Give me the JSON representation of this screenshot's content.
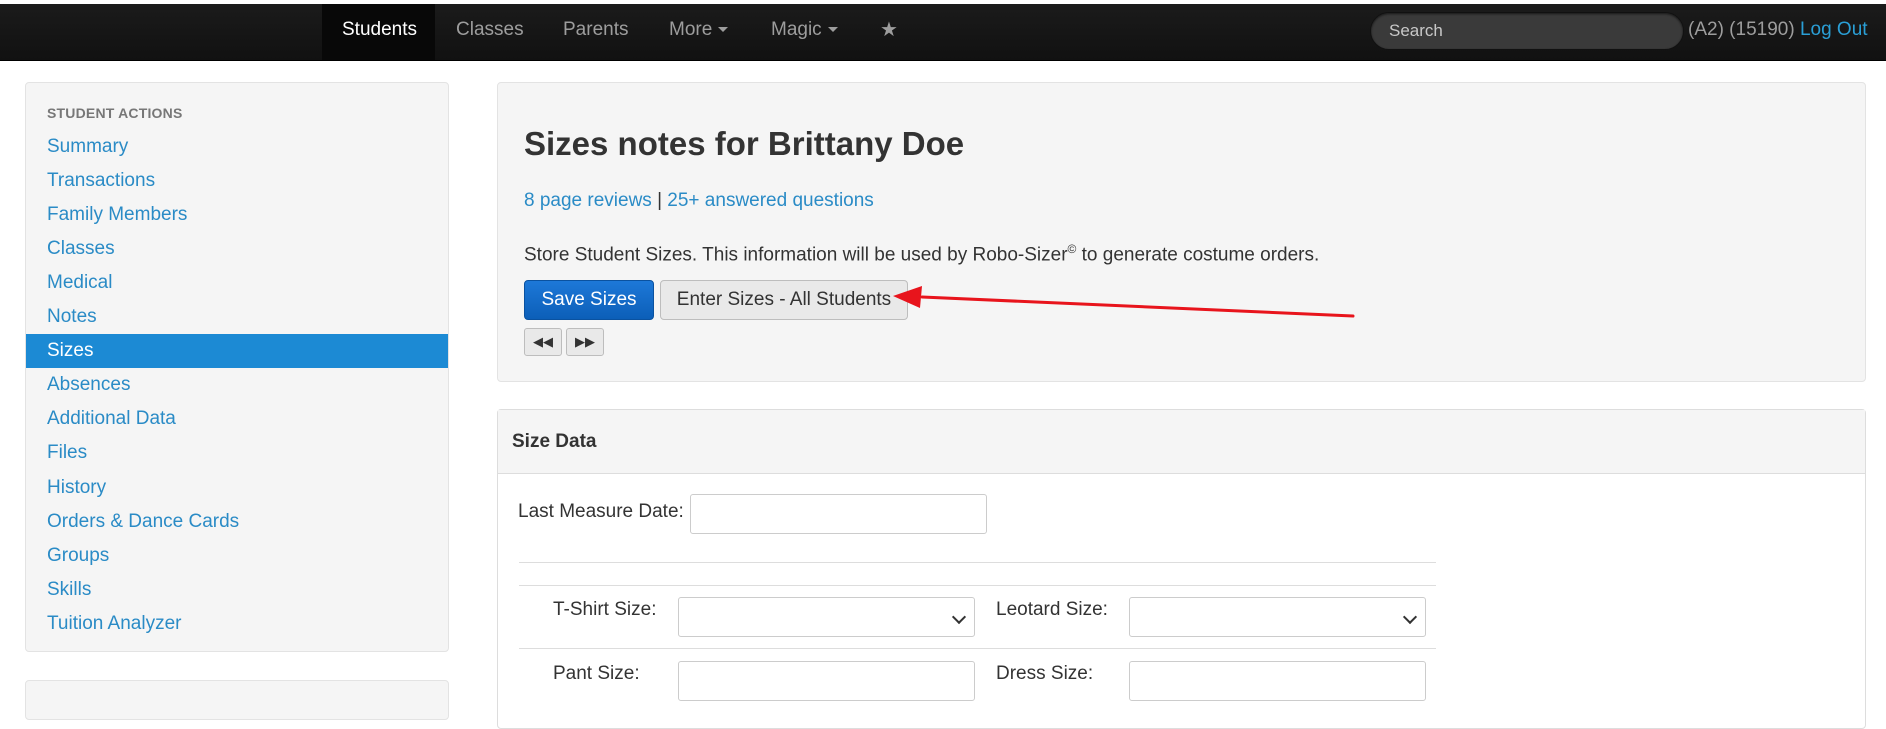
{
  "navbar": {
    "items": [
      {
        "label": "Students",
        "active": true
      },
      {
        "label": "Classes"
      },
      {
        "label": "Parents"
      },
      {
        "label": "More",
        "dropdown": true
      },
      {
        "label": "Magic",
        "dropdown": true
      }
    ],
    "star_icon": "star-icon",
    "search_placeholder": "Search",
    "user_info": "(A2) (15190)",
    "logout_label": "Log Out"
  },
  "sidebar": {
    "header": "STUDENT ACTIONS",
    "items": [
      {
        "label": "Summary"
      },
      {
        "label": "Transactions"
      },
      {
        "label": "Family Members"
      },
      {
        "label": "Classes"
      },
      {
        "label": "Medical"
      },
      {
        "label": "Notes"
      },
      {
        "label": "Sizes",
        "active": true
      },
      {
        "label": "Absences"
      },
      {
        "label": "Additional Data"
      },
      {
        "label": "Files"
      },
      {
        "label": "History"
      },
      {
        "label": "Orders & Dance Cards"
      },
      {
        "label": "Groups"
      },
      {
        "label": "Skills"
      },
      {
        "label": "Tuition Analyzer"
      }
    ]
  },
  "main": {
    "title": "Sizes notes for Brittany Doe",
    "reviews_link": "8 page reviews",
    "separator": "|",
    "questions_link": "25+ answered questions",
    "desc_before": "Store Student Sizes. This information will be used by Robo-Sizer",
    "desc_sup": "©",
    "desc_after": " to generate costume orders.",
    "save_button": "Save Sizes",
    "enter_all_button": "Enter Sizes - All Students",
    "prev_icon": "backward-icon",
    "next_icon": "forward-icon",
    "arrow_color": "#e8141c"
  },
  "size_panel": {
    "title": "Size Data",
    "last_measure_label": "Last Measure Date:",
    "last_measure_value": "",
    "tshirt_label": "T-Shirt Size:",
    "tshirt_value": "",
    "leotard_label": "Leotard Size:",
    "leotard_value": "",
    "pant_label": "Pant Size:",
    "pant_value": "",
    "dress_label": "Dress Size:",
    "dress_value": ""
  },
  "colors": {
    "navbar_bg": "#1b1b1b",
    "link": "#2a8bc6",
    "active_sidebar": "#1c8ad4",
    "primary_button": "#1d78d8"
  }
}
